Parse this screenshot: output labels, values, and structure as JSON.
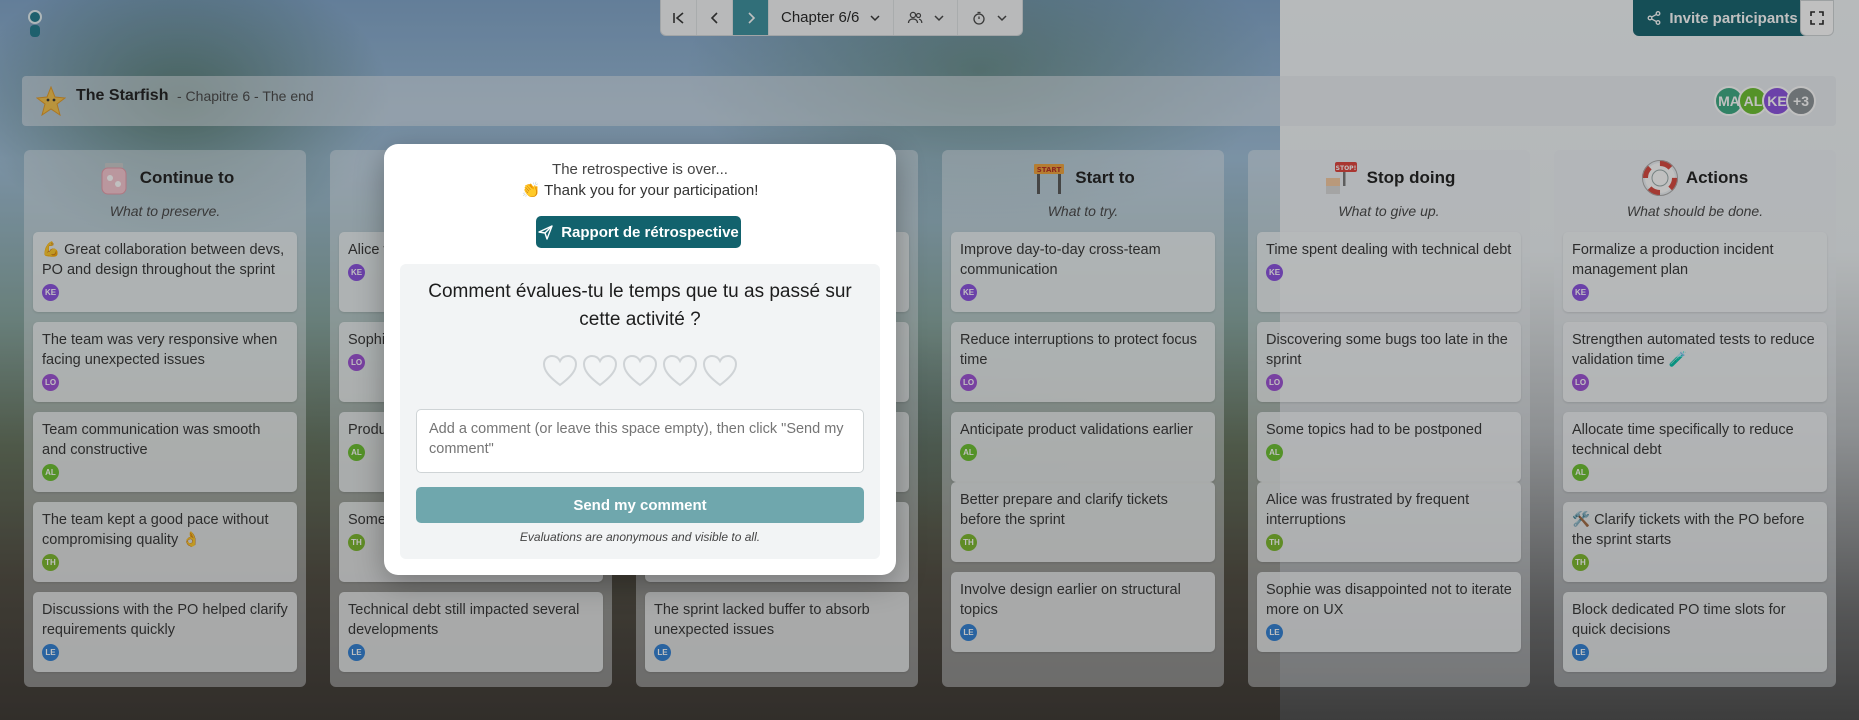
{
  "toolbar": {
    "chapter_label": "Chapter 6/6"
  },
  "invite": {
    "label": "Invite participants"
  },
  "board": {
    "title": "The Starfish",
    "subtitle": "- Chapitre 6 - The end"
  },
  "participants": {
    "avatars": [
      {
        "initials": "MA",
        "color": "#3aa981"
      },
      {
        "initials": "AL",
        "color": "#6abf2d"
      },
      {
        "initials": "KE",
        "color": "#8a4fe0"
      },
      {
        "initials": "+3",
        "color": "#8b9296"
      }
    ]
  },
  "avatar_colors": {
    "KE": "#8a4fe0",
    "LO": "#9b4fd4",
    "AL": "#6abf2d",
    "TH": "#7ab82a",
    "LE": "#2e7fd3"
  },
  "columns": [
    {
      "title": "Continue to",
      "subtitle": "What to preserve.",
      "icon": "jar-icon",
      "cards": [
        {
          "text": "💪 Great collaboration between devs, PO and design throughout the sprint",
          "author": "KE"
        },
        {
          "text": "The team was very responsive when facing unexpected issues",
          "author": "LO"
        },
        {
          "text": "Team communication was smooth and constructive",
          "author": "AL"
        },
        {
          "text": "The team kept a good pace without compromising quality 👌",
          "author": "TH"
        },
        {
          "text": "Discussions with the PO helped clarify requirements quickly",
          "author": "LE"
        }
      ]
    },
    {
      "title": "",
      "subtitle": "",
      "icon": "",
      "cards": [
        {
          "text": "Alice w tasks,",
          "author": "KE"
        },
        {
          "text": "Sophi key so",
          "author": "LO"
        },
        {
          "text": "Produ exped",
          "author": "AL"
        },
        {
          "text": "Some the sp",
          "author": "TH"
        },
        {
          "text": "Technical debt still impacted several developments",
          "author": "LE"
        }
      ]
    },
    {
      "title": "",
      "subtitle": "",
      "icon": "",
      "cards": [
        {
          "text": "",
          "author": ""
        },
        {
          "text": "",
          "author": ""
        },
        {
          "text": "",
          "author": ""
        },
        {
          "text": "",
          "author": ""
        },
        {
          "text": "The sprint lacked buffer to absorb unexpected issues",
          "author": "LE"
        }
      ]
    },
    {
      "title": "Start to",
      "subtitle": "What to try.",
      "icon": "start-sign-icon",
      "cards": [
        {
          "text": "Improve day-to-day cross-team communication",
          "author": "KE"
        },
        {
          "text": "Reduce interruptions to protect focus time",
          "author": "LO"
        },
        {
          "text": "Anticipate product validations earlier",
          "author": "AL"
        },
        {
          "text": "Better prepare and clarify tickets before the sprint",
          "author": "TH"
        },
        {
          "text": "Involve design earlier on structural topics",
          "author": "LE"
        }
      ]
    },
    {
      "title": "Stop doing",
      "subtitle": "What to give up.",
      "icon": "stop-sign-icon",
      "cards": [
        {
          "text": "Time spent dealing with technical debt",
          "author": "KE"
        },
        {
          "text": "Discovering some bugs too late in the sprint",
          "author": "LO"
        },
        {
          "text": "Some topics had to be postponed",
          "author": "AL"
        },
        {
          "text": "Alice was frustrated by frequent interruptions",
          "author": "TH"
        },
        {
          "text": "Sophie was disappointed not to iterate more on UX",
          "author": "LE"
        }
      ]
    },
    {
      "title": "Actions",
      "subtitle": "What should be done.",
      "icon": "lifebuoy-icon",
      "cards": [
        {
          "text": "Formalize a production incident management plan",
          "author": "KE"
        },
        {
          "text": "Strengthen automated tests to reduce validation time 🧪",
          "author": "LO"
        },
        {
          "text": "Allocate time specifically to reduce technical debt",
          "author": "AL"
        },
        {
          "text": "🛠️ Clarify tickets with the PO before the sprint starts",
          "author": "TH"
        },
        {
          "text": "Block dedicated PO time slots for quick decisions",
          "author": "LE"
        }
      ]
    }
  ],
  "modal": {
    "over_text": "The retrospective is over...",
    "thanks_text": "👏 Thank you for your participation!",
    "report_label": "Rapport de rétrospective",
    "question": "Comment évalues-tu le temps que tu as passé sur cette activité ?",
    "rating_max": 5,
    "rating_value": 0,
    "comment_placeholder": "Add a comment (or leave this space empty), then click \"Send my comment\"",
    "send_label": "Send my comment",
    "note": "Evaluations are anonymous and visible to all."
  }
}
